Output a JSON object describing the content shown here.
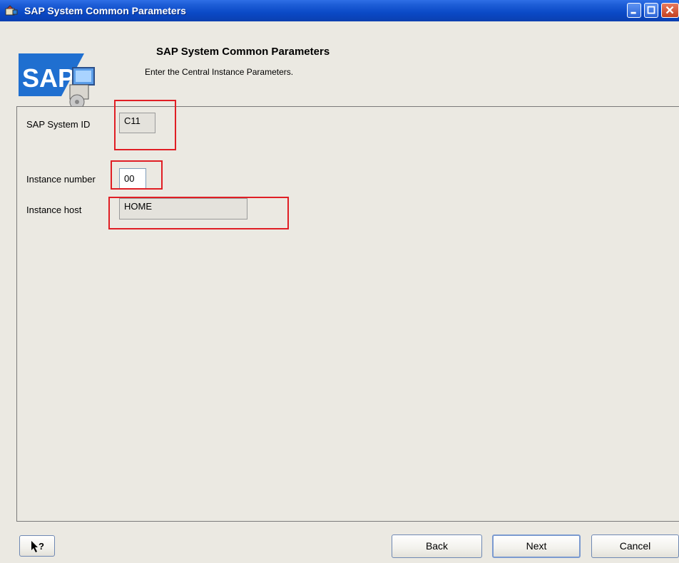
{
  "window": {
    "title": "SAP System Common Parameters",
    "controls": [
      "minimize",
      "maximize",
      "close"
    ]
  },
  "header": {
    "logo_text": "SAP",
    "title": "SAP System Common Parameters",
    "subtitle": "Enter the Central Instance Parameters."
  },
  "form": {
    "system_id": {
      "label": "SAP System ID",
      "value": "C11"
    },
    "instance_number": {
      "label": "Instance number",
      "value": "00"
    },
    "instance_host": {
      "label": "Instance host",
      "value": "HOME"
    }
  },
  "buttons": {
    "help": "help-cursor-icon",
    "back": "Back",
    "next": "Next",
    "cancel": "Cancel"
  },
  "colors": {
    "titlebar": "#0a49c6",
    "background": "#ebe9e2",
    "highlight": "#e01e24"
  }
}
